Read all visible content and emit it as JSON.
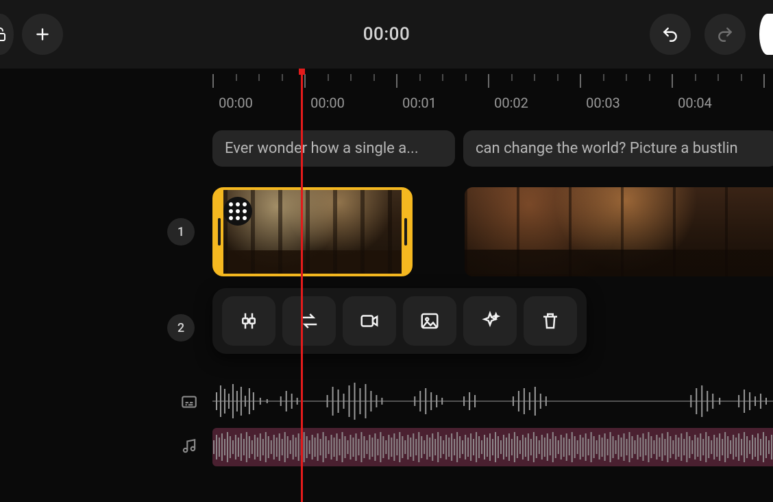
{
  "header": {
    "current_time": "00:00"
  },
  "ruler": {
    "labels": [
      "00:00",
      "00:00",
      "00:01",
      "00:02",
      "00:03",
      "00:04"
    ]
  },
  "text_clips": [
    {
      "text": "Ever wonder how a single a..."
    },
    {
      "text": "can change the world? Picture a bustlin"
    }
  ],
  "tracks": {
    "track1_label": "1",
    "track2_label": "2"
  },
  "clip_actions": {
    "split": "split-icon",
    "swap": "swap-icon",
    "video": "video-icon",
    "image": "image-icon",
    "sparkle": "sparkle-icon",
    "delete": "delete-icon"
  },
  "icons": {
    "lock": "lock-icon",
    "add": "plus-icon",
    "undo": "undo-icon",
    "redo": "redo-icon",
    "subtitle": "subtitle-icon",
    "music": "music-icon"
  }
}
